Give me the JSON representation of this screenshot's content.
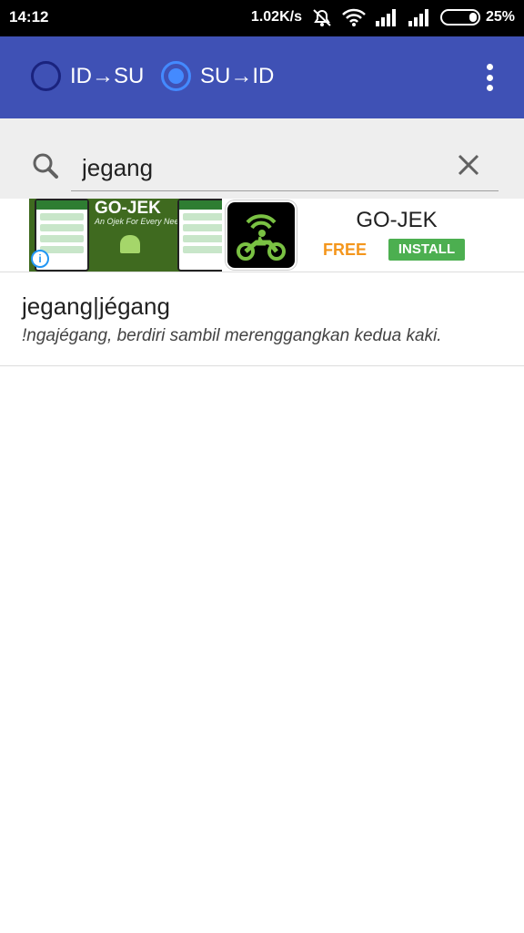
{
  "status_bar": {
    "time": "14:12",
    "net_speed": "1.02K/s",
    "battery": "25%",
    "icons": [
      "mute-icon",
      "wifi-icon",
      "signal-icon",
      "signal-icon",
      "battery-icon"
    ]
  },
  "app_bar": {
    "options": [
      {
        "label": "ID→SU",
        "checked": false
      },
      {
        "label": "SU→ID",
        "checked": true
      }
    ],
    "menu_icon": "overflow-menu-icon",
    "color": "#3f51b5",
    "accent": "#448aff"
  },
  "search": {
    "value": "jegang",
    "icon": "search-icon",
    "clear_icon": "close-icon"
  },
  "ad": {
    "brand_text": "GO-JEK",
    "tagline": "An Ojek For Every Need",
    "title": "GO-JEK",
    "price": "FREE",
    "cta": "INSTALL",
    "info_icon": "info-icon"
  },
  "results": [
    {
      "term": "jegang|jégang",
      "definition": "!ngajégang, berdiri sambil merenggangkan kedua kaki."
    }
  ]
}
